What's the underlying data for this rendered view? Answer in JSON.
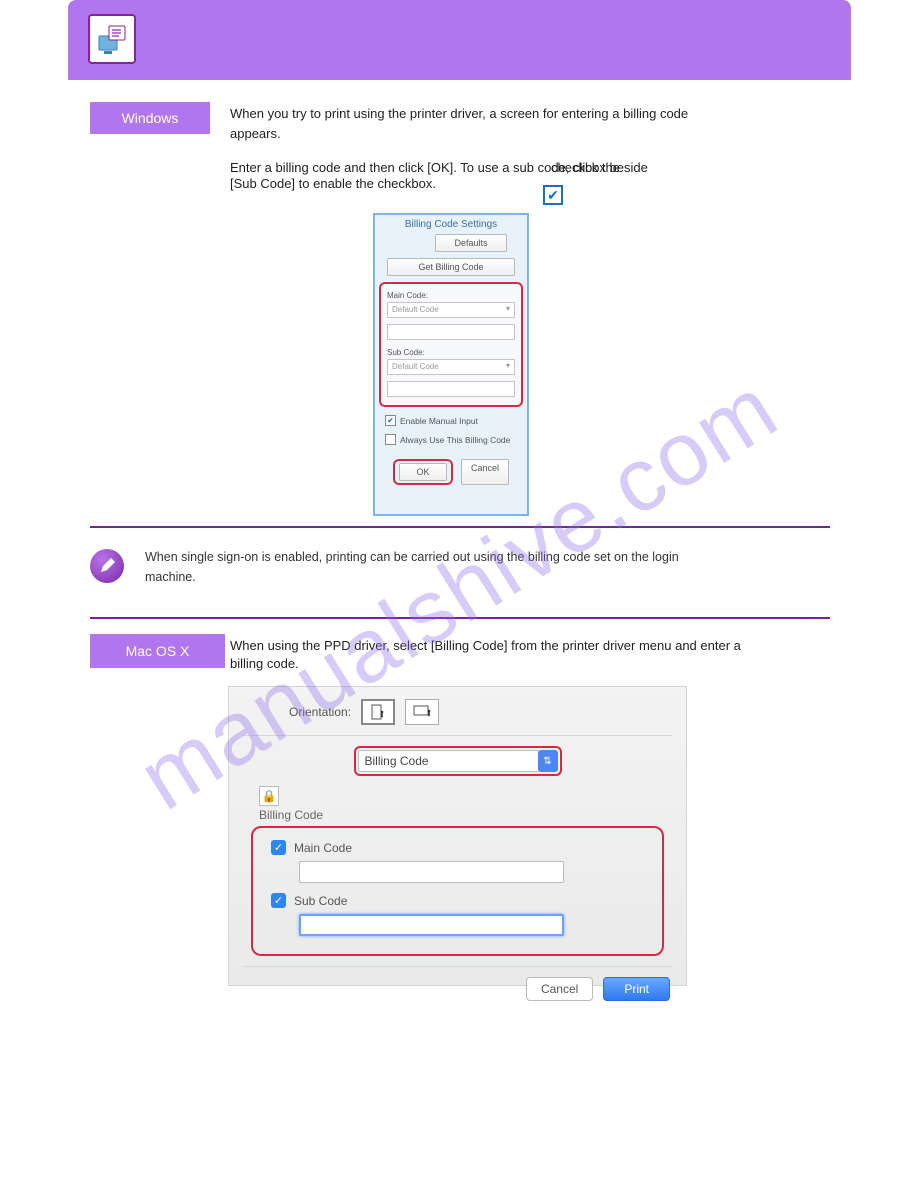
{
  "badges": {
    "windows": "Windows",
    "macosx": "Mac OS X"
  },
  "step1": {
    "line1": "When you try to print using the printer driver, a screen for entering a billing code",
    "line2": "appears.",
    "line3": "Enter a billing code and then click [OK]. To use a sub code, click the",
    "line4": "checkbox beside",
    "line5": "[Sub Code] to enable the checkbox."
  },
  "win_dialog": {
    "title": "Billing Code Settings",
    "defaults": "Defaults",
    "get_billing": "Get Billing Code",
    "main_code_label": "Main Code:",
    "default_code": "Default Code",
    "sub_code_label": "Sub Code:",
    "enable_manual": "Enable Manual Input",
    "always_use": "Always Use This Billing Code",
    "ok": "OK",
    "cancel": "Cancel"
  },
  "note": {
    "line1": "When single sign-on is enabled, printing can be carried out using the billing code set on the login",
    "line2": "machine."
  },
  "step2": {
    "line1": "When using the PPD driver, select [Billing Code] from the printer driver menu and enter a",
    "line2": "billing code."
  },
  "mac_dialog": {
    "orientation_label": "Orientation:",
    "select_value": "Billing Code",
    "bc_heading": "Billing Code",
    "main_code": "Main Code",
    "sub_code": "Sub Code",
    "cancel": "Cancel",
    "print": "Print"
  },
  "watermark": "manualshive.com"
}
